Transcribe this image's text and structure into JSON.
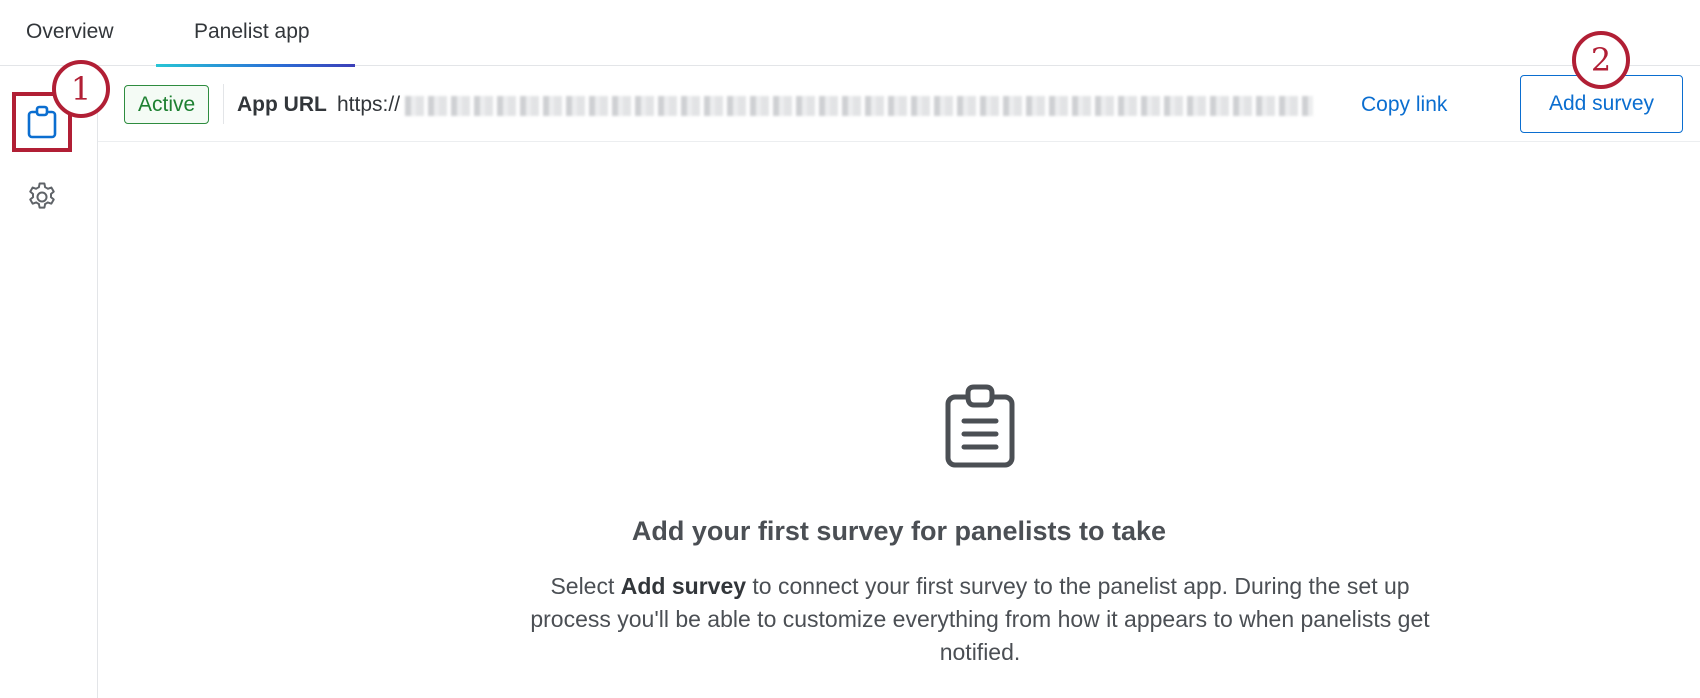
{
  "tabs": [
    {
      "label": "Overview",
      "active": false
    },
    {
      "label": "Panelist app",
      "active": true
    }
  ],
  "sidebar": {
    "items": [
      {
        "icon": "clipboard-icon",
        "selected": true
      },
      {
        "icon": "gear-icon",
        "selected": false
      }
    ]
  },
  "callouts": [
    "1",
    "2"
  ],
  "toolbar": {
    "status": "Active",
    "app_url_label": "App URL",
    "app_url_value": "https://",
    "copy_link_label": "Copy link",
    "add_survey_label": "Add survey"
  },
  "empty_state": {
    "icon": "clipboard-list-icon",
    "title": "Add your first survey for panelists to take",
    "desc_prefix": "Select ",
    "desc_bold": "Add survey",
    "desc_suffix": " to connect your first survey to the panelist app. During the set up process you'll be able to customize everything from how it appears to when panelists get notified."
  },
  "colors": {
    "accent": "#0b6ed0",
    "highlight": "#b11f35",
    "active_green": "#1d8031"
  }
}
